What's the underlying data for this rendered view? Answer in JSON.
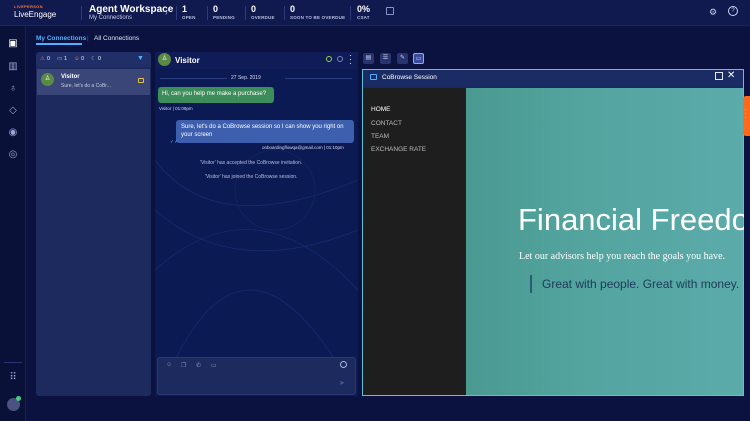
{
  "brand": {
    "small": "LIVEPERSON",
    "name": "LiveEngage"
  },
  "workspace": {
    "title": "Agent Workspace",
    "subtitle": "My Connections"
  },
  "stats": [
    {
      "value": "1",
      "label": "OPEN"
    },
    {
      "value": "0",
      "label": "PENDING"
    },
    {
      "value": "0",
      "label": "OVERDUE"
    },
    {
      "value": "0",
      "label": "SOON TO BE OVERDUE"
    },
    {
      "value": "0%",
      "label": "CSAT"
    }
  ],
  "header_icons": {
    "settings": "gear-icon",
    "help": "help-icon",
    "help_glyph": "?"
  },
  "rail": [
    "conversations-icon",
    "analytics-icon",
    "ribbon-icon",
    "tag-icon",
    "user-icon",
    "team-icon",
    "apps-grid-icon"
  ],
  "tabs": {
    "active": "My Connections",
    "other": "All Connections"
  },
  "counters": [
    {
      "icon": "alert-icon",
      "value": "0",
      "color": "#ff5a5a"
    },
    {
      "icon": "chat-icon",
      "value": "1",
      "color": "#e6c14a"
    },
    {
      "icon": "agent-icon",
      "value": "0",
      "color": "#ff9a3a"
    },
    {
      "icon": "moon-icon",
      "value": "0",
      "color": "#aab2dd"
    }
  ],
  "conversation": {
    "name": "Visitor",
    "snippet": "Sure, let's do a CoBr..."
  },
  "chat": {
    "title": "Visitor",
    "date": "27 Sep. 2019",
    "messages": {
      "visitor_text": "Hi, can you help me make a purchase?",
      "visitor_meta": "Visitor | 01:09pm",
      "agent_text": "Sure, let's do a CoBrowse session so I can show you right on your screen",
      "agent_meta": "onboardingflowqa@gmail.com | 01:10pm"
    },
    "system": [
      "'Visitor' has accepted the CoBrowse invitation.",
      "'Visitor' has joined the CoBrowse session."
    ]
  },
  "cobrowse": {
    "title": "CoBrowse Session",
    "nav": [
      "HOME",
      "CONTACT",
      "TEAM",
      "EXCHANGE RATE"
    ],
    "hero_title": "Financial Freedo",
    "hero_sub": "Let our advisors help you reach the goals you have.",
    "hero_quote": "Great with people. Great with money."
  },
  "colors": {
    "accent": "#4fb0ff",
    "visitor_bubble": "#3d8d5b",
    "agent_bubble": "#3d5fae",
    "cobrowse_border": "#5cc3d6",
    "side_handle": "#ff6a1a"
  }
}
